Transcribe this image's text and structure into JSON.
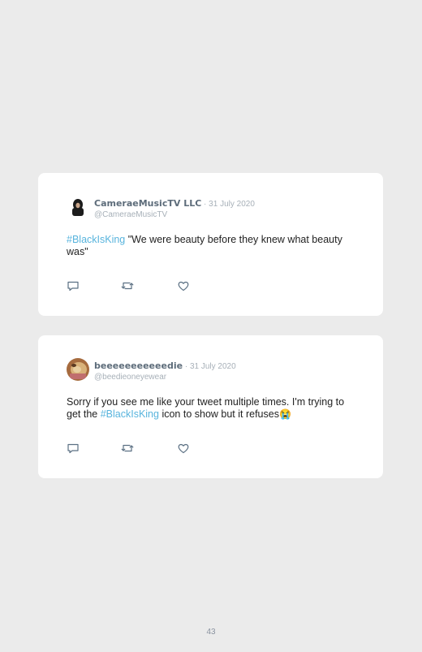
{
  "tweets": [
    {
      "display_name": "CameraeMusicTV LLC",
      "separator": " · ",
      "date": "31 July 2020",
      "handle": "@CameraeMusicTV",
      "hashtag": "#BlackIsKing",
      "text_after": " \"We were beauty before they knew what beauty was\""
    },
    {
      "display_name": "beeeeeeeeeeedie",
      "separator": " · ",
      "date": "31 July 2020",
      "handle": "@beedieoneyewear",
      "text_before": "Sorry if you see me like your tweet multiple times. I'm trying to get the ",
      "hashtag": "#BlackIsKing",
      "text_after": " icon to show but it refuses",
      "emoji": "😭"
    }
  ],
  "actions": {
    "reply_icon": "reply-icon",
    "retweet_icon": "retweet-icon",
    "like_icon": "heart-icon"
  },
  "colors": {
    "hashtag": "#58b4dd",
    "name": "#5d6c7a",
    "meta": "#a7b0b8"
  },
  "page_number": "43"
}
